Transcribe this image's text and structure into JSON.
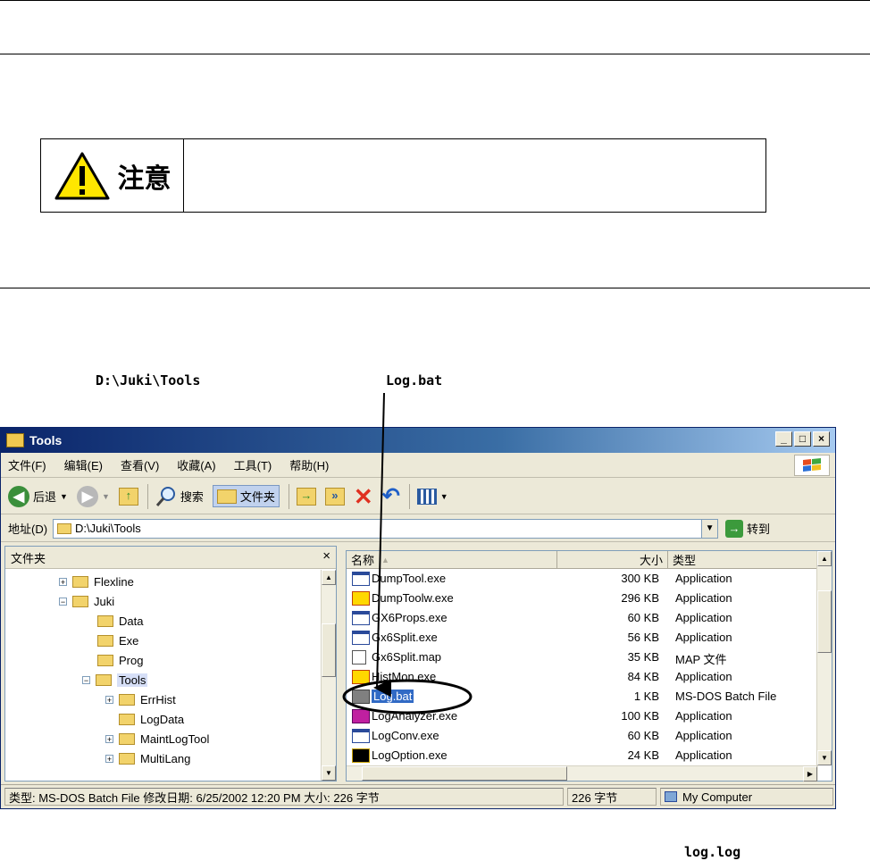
{
  "caution": {
    "label": "注意"
  },
  "labels": {
    "path_label": "D:\\Juki\\Tools",
    "file_label": "Log.bat",
    "bottom_label": "log.log"
  },
  "window": {
    "title": "Tools",
    "menu": [
      "文件(F)",
      "编辑(E)",
      "查看(V)",
      "收藏(A)",
      "工具(T)",
      "帮助(H)"
    ],
    "toolbar": {
      "back": "后退",
      "search": "搜索",
      "folders": "文件夹"
    },
    "address": {
      "label": "地址(D)",
      "value": "D:\\Juki\\Tools",
      "go": "转到"
    },
    "folders_pane": {
      "title": "文件夹",
      "close": "×",
      "tree": [
        {
          "label": "Flexline",
          "level": 1,
          "expander": "+"
        },
        {
          "label": "Juki",
          "level": 1,
          "expander": "−"
        },
        {
          "label": "Data",
          "level": 2,
          "expander": ""
        },
        {
          "label": "Exe",
          "level": 2,
          "expander": ""
        },
        {
          "label": "Prog",
          "level": 2,
          "expander": ""
        },
        {
          "label": "Tools",
          "level": 2,
          "expander": "−",
          "selected": true
        },
        {
          "label": "ErrHist",
          "level": 3,
          "expander": "+"
        },
        {
          "label": "LogData",
          "level": 3,
          "expander": ""
        },
        {
          "label": "MaintLogTool",
          "level": 3,
          "expander": "+"
        },
        {
          "label": "MultiLang",
          "level": 3,
          "expander": "+"
        }
      ]
    },
    "file_list": {
      "columns": {
        "name": "名称",
        "size": "大小",
        "type": "类型"
      },
      "files": [
        {
          "name": "DumpTool.exe",
          "size": "300 KB",
          "type": "Application",
          "icon": "app-window-icon"
        },
        {
          "name": "DumpToolw.exe",
          "size": "296 KB",
          "type": "Application",
          "icon": "dump-tool-icon"
        },
        {
          "name": "GX6Props.exe",
          "size": "60 KB",
          "type": "Application",
          "icon": "app-window-icon"
        },
        {
          "name": "Gx6Split.exe",
          "size": "56 KB",
          "type": "Application",
          "icon": "app-window-icon"
        },
        {
          "name": "Gx6Split.map",
          "size": "35 KB",
          "type": "MAP 文件",
          "icon": "map-file-icon"
        },
        {
          "name": "HistMon.exe",
          "size": "84 KB",
          "type": "Application",
          "icon": "hist-mon-icon"
        },
        {
          "name": "Log.bat",
          "size": "1 KB",
          "type": "MS-DOS Batch File",
          "icon": "batch-file-icon",
          "selected": true
        },
        {
          "name": "LogAnalyzer.exe",
          "size": "100 KB",
          "type": "Application",
          "icon": "log-analyzer-icon"
        },
        {
          "name": "LogConv.exe",
          "size": "60 KB",
          "type": "Application",
          "icon": "app-window-icon"
        },
        {
          "name": "LogOption.exe",
          "size": "24 KB",
          "type": "Application",
          "icon": "log-option-icon"
        }
      ]
    },
    "status": {
      "info": "类型: MS-DOS Batch File 修改日期: 6/25/2002 12:20 PM 大小: 226 字节",
      "size": "226 字节",
      "zone": "My Computer"
    }
  }
}
